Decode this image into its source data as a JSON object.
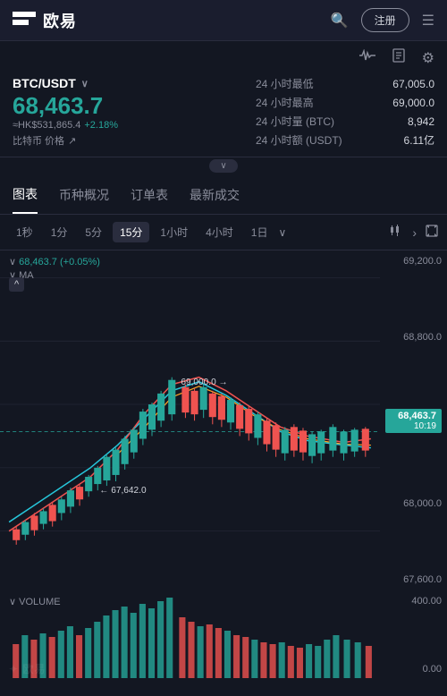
{
  "header": {
    "logo_text": "欧易",
    "register_label": "注册",
    "menu_icon": "☰",
    "search_icon": "🔍"
  },
  "toolbar": {
    "pulse_icon": "♡",
    "document_icon": "📋",
    "settings_icon": "⚙"
  },
  "pair": {
    "name": "BTC/USDT",
    "chevron": "∨",
    "main_price": "68,463.7",
    "hk_price": "≈HK$531,865.4",
    "price_change": "+2.18%",
    "btc_label": "比特币 价格",
    "external_icon": "↗"
  },
  "stats": {
    "low_label": "24 小时最低",
    "low_value": "67,005.0",
    "high_label": "24 小时最高",
    "high_value": "69,000.0",
    "vol_btc_label": "24 小时量 (BTC)",
    "vol_btc_value": "8,942",
    "vol_usdt_label": "24 小时额 (USDT)",
    "vol_usdt_value": "6.11亿"
  },
  "collapse": {
    "icon": "∨"
  },
  "tabs": [
    {
      "label": "图表",
      "active": true
    },
    {
      "label": "币种概况",
      "active": false
    },
    {
      "label": "订单表",
      "active": false
    },
    {
      "label": "最新成交",
      "active": false
    }
  ],
  "time_buttons": [
    {
      "label": "1秒",
      "active": false
    },
    {
      "label": "1分",
      "active": false
    },
    {
      "label": "5分",
      "active": false
    },
    {
      "label": "15分",
      "active": true
    },
    {
      "label": "1小时",
      "active": false
    },
    {
      "label": "4小时",
      "active": false
    },
    {
      "label": "1日",
      "active": false
    }
  ],
  "chart": {
    "price_info": "68,463.7 (+0.05%)",
    "ma_label": "MA",
    "expand_label": "^",
    "current_price": "68,463.7",
    "current_time": "10:19",
    "annotation": "69,000.0 →",
    "annotation2": "← 67,642.0",
    "y_labels": [
      "69,200.0",
      "68,800.0",
      "",
      "68,000.0",
      "67,600.0"
    ],
    "y_current_index": 2
  },
  "volume": {
    "label": "VOLUME",
    "y_labels": [
      "400.00",
      "0.00"
    ]
  },
  "watermark": "✦ 欧易"
}
